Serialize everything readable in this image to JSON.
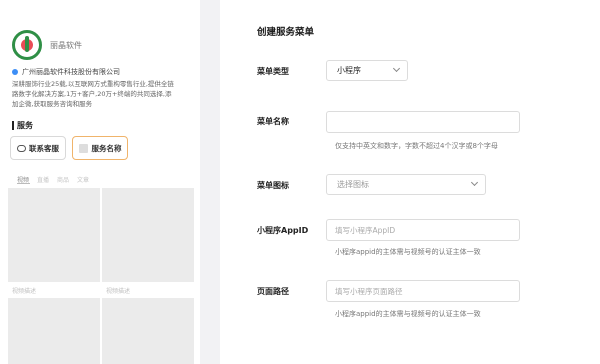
{
  "preview": {
    "brand_name": "丽晶软件",
    "company": "广州丽晶软件科技股份有限公司",
    "description": "深耕服饰行业25载,以互联网方式重构零售行业,提供全链\n路数字化解决方案,1万+客户,20万+终端的共同选择,添\n加企微,获取服务咨询和服务",
    "services_title": "服务",
    "contact_button": "联系客服",
    "service_name_button": "服务名称",
    "tabs": [
      "视频",
      "直播",
      "商品",
      "文章"
    ],
    "tile_captions": [
      "视频描述",
      "视频描述"
    ]
  },
  "form": {
    "title": "创建服务菜单",
    "menu_type_label": "菜单类型",
    "menu_type_value": "小程序",
    "menu_name_label": "菜单名称",
    "menu_name_value": "",
    "menu_name_hint": "仅支持中英文和数字，字数不超过4个汉字或8个字母",
    "menu_icon_label": "菜单图标",
    "menu_icon_placeholder": "选择图标",
    "appid_label": "小程序AppID",
    "appid_placeholder": "填写小程序AppID",
    "appid_hint": "小程序appid的主体需与视频号的认证主体一致",
    "path_label": "页面路径",
    "path_placeholder": "填写小程序页面路径",
    "path_hint": "小程序appid的主体需与视频号的认证主体一致"
  },
  "colors": {
    "background": "#f2f2f4",
    "brand_green": "#2f8f46",
    "brand_red": "#e94c57",
    "verify_blue": "#3d8ef6",
    "selected_outline": "#f0b46b"
  }
}
